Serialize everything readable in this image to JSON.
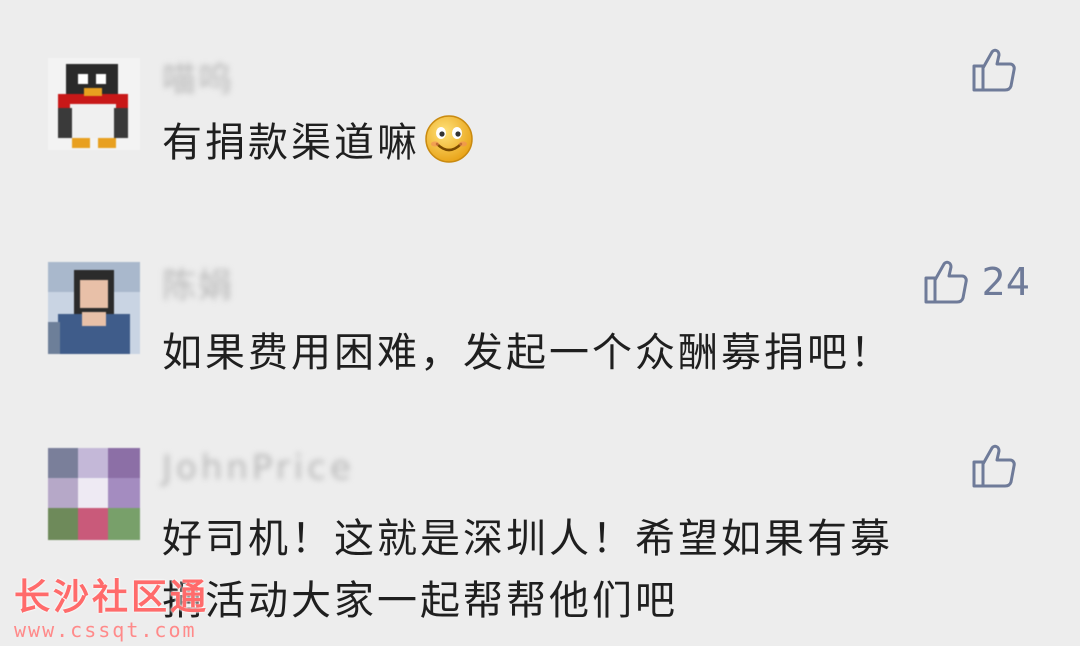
{
  "comments": [
    {
      "name": "喵呜",
      "text": "有捐款渠道嘛",
      "emoji": "smile-emoji",
      "likes": ""
    },
    {
      "name": "陈娟",
      "text": "如果费用困难，发起一个众酬募捐吧！",
      "likes": "24"
    },
    {
      "name": "JohnPrice",
      "text_line1": "好司机！这就是深圳人！希望如果有募",
      "text_line2": "捐活动大家一起帮帮他们吧",
      "likes": ""
    }
  ],
  "watermark": {
    "title": "长沙社区通",
    "url": "www.cssqt.com"
  },
  "icons": {
    "like": "thumbs-up-icon"
  },
  "colors": {
    "background": "#ededed",
    "like_icon": "#6f7b99",
    "watermark": "#ff6b6b"
  }
}
